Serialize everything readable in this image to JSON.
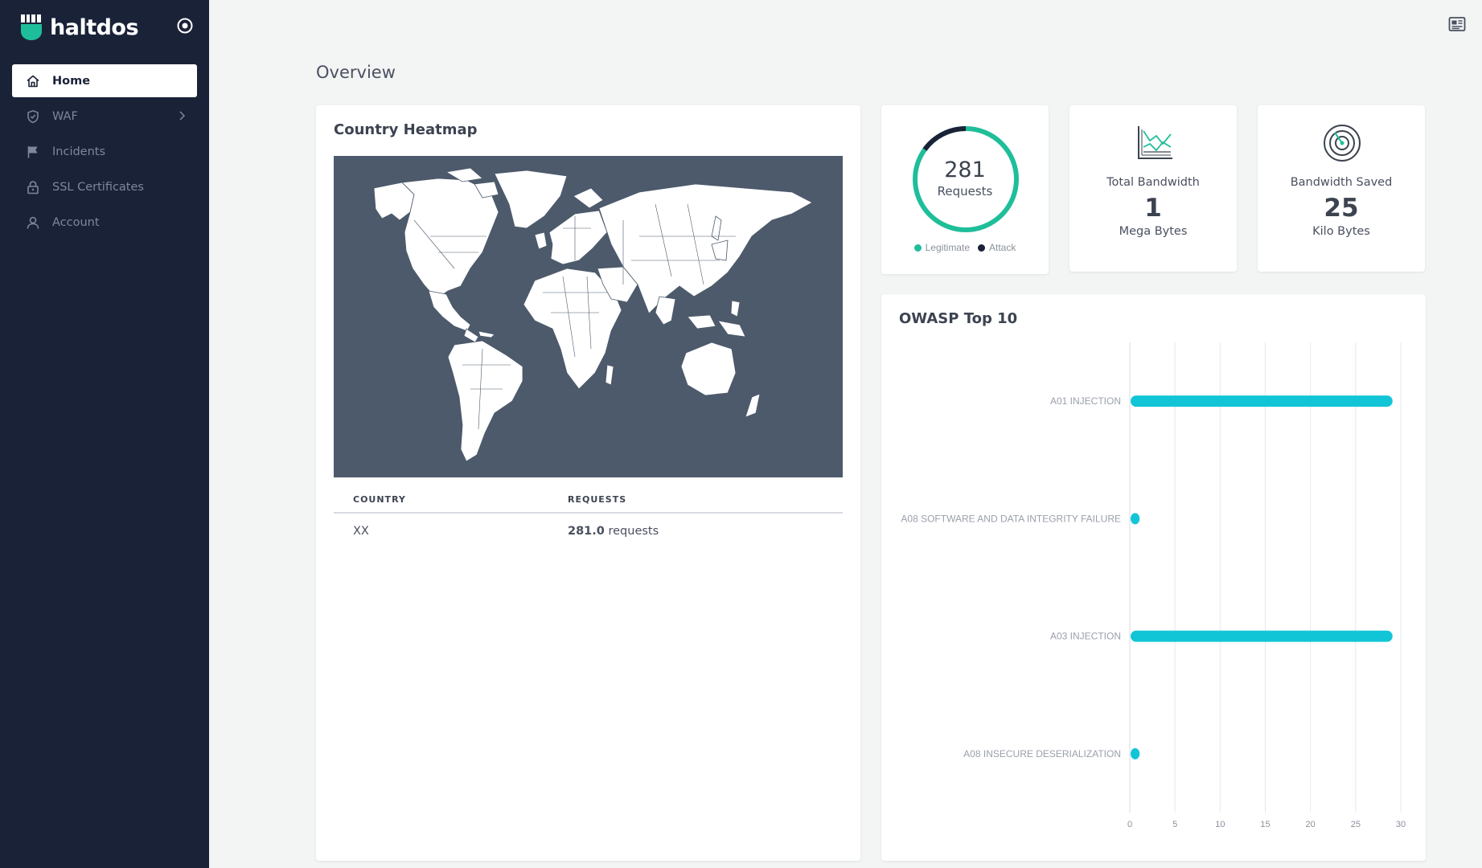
{
  "brand": {
    "name": "haltdos"
  },
  "sidebar": {
    "items": [
      {
        "label": "Home",
        "icon": "home-icon",
        "active": true
      },
      {
        "label": "WAF",
        "icon": "shield-icon",
        "active": false,
        "has_submenu": true
      },
      {
        "label": "Incidents",
        "icon": "flag-icon",
        "active": false
      },
      {
        "label": "SSL Certificates",
        "icon": "lock-icon",
        "active": false
      },
      {
        "label": "Account",
        "icon": "user-icon",
        "active": false
      }
    ]
  },
  "header": {
    "top_right_icon": "newspaper-icon"
  },
  "page": {
    "title": "Overview"
  },
  "heatmap": {
    "title": "Country Heatmap",
    "columns": [
      "COUNTRY",
      "REQUESTS"
    ],
    "rows": [
      {
        "country": "XX",
        "requests_value": "281.0",
        "requests_unit": "requests"
      }
    ]
  },
  "requests": {
    "value": "281",
    "label": "Requests",
    "legitimate_fraction": 0.85,
    "legend": [
      {
        "label": "Legitimate",
        "color": "#1fbe9a"
      },
      {
        "label": "Attack",
        "color": "#1a2238"
      }
    ]
  },
  "bandwidth": {
    "label": "Total Bandwidth",
    "value": "1",
    "unit": "Mega Bytes"
  },
  "saved": {
    "label": "Bandwidth Saved",
    "value": "25",
    "unit": "Kilo Bytes"
  },
  "colors": {
    "accent": "#1fbe9a",
    "bar": "#12c5d6",
    "sidebar": "#1a2238",
    "map_bg": "#4c5a6b"
  },
  "owasp": {
    "title": "OWASP Top 10",
    "chart_data": {
      "type": "bar",
      "orientation": "horizontal",
      "categories": [
        "A01 INJECTION",
        "A08 SOFTWARE AND DATA INTEGRITY FAILURE",
        "A03 INJECTION",
        "A08 INSECURE DESERIALIZATION"
      ],
      "values": [
        29,
        1,
        29,
        1
      ],
      "xlim": [
        0,
        30
      ],
      "xticks": [
        "0",
        "5",
        "10",
        "15",
        "20",
        "25",
        "30"
      ],
      "grid": true
    }
  }
}
